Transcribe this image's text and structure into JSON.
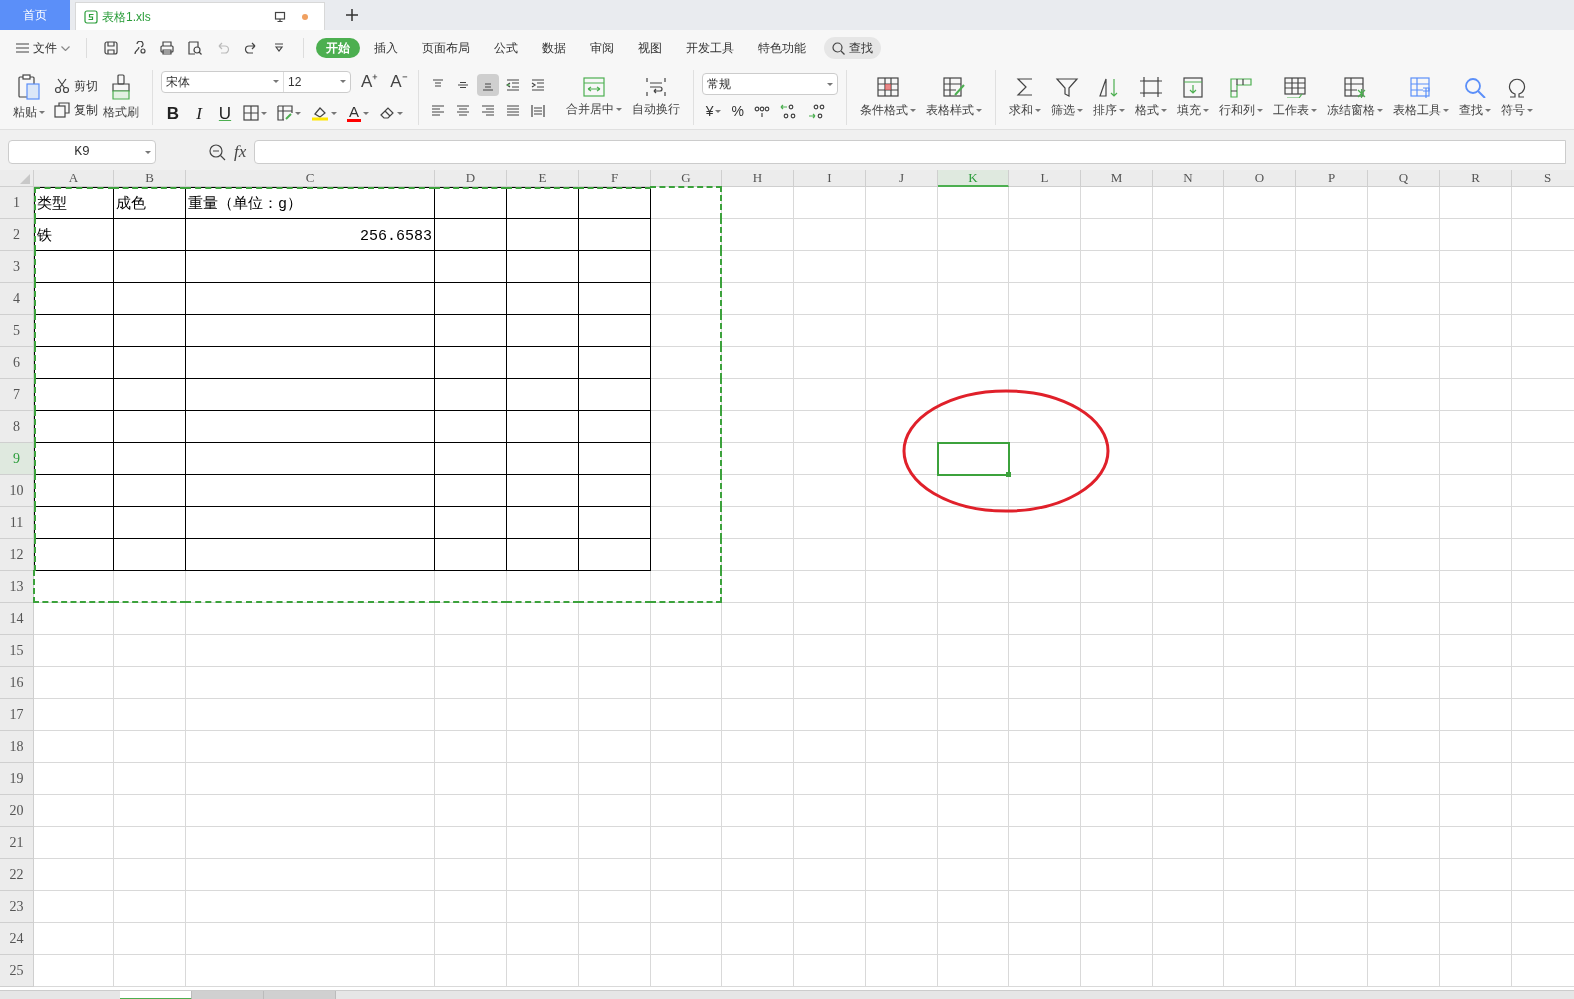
{
  "tabs": [
    {
      "label": "首页",
      "kind": "home",
      "selected": false
    },
    {
      "label": "表格1.xls",
      "kind": "file",
      "selected": true,
      "unsaved": true
    }
  ],
  "menu": {
    "file": "文件",
    "items": [
      {
        "label": "开始",
        "selected": true
      },
      {
        "label": "插入",
        "selected": false
      },
      {
        "label": "页面布局",
        "selected": false
      },
      {
        "label": "公式",
        "selected": false
      },
      {
        "label": "数据",
        "selected": false
      },
      {
        "label": "审阅",
        "selected": false
      },
      {
        "label": "视图",
        "selected": false
      },
      {
        "label": "开发工具",
        "selected": false
      },
      {
        "label": "特色功能",
        "selected": false
      }
    ],
    "search": "查找"
  },
  "clipboard": {
    "paste": "粘贴",
    "cut": "剪切",
    "copy": "复制",
    "painter": "格式刷"
  },
  "font": {
    "name": "宋体",
    "size": "12",
    "size_buttons": [
      "A⁺",
      "A⁻"
    ],
    "styles": [
      "B",
      "I",
      "U"
    ],
    "color_letter": "A"
  },
  "align": {
    "top_row": [
      {
        "selected": false
      },
      {
        "selected": false
      },
      {
        "selected": true
      },
      {
        "selected": false
      },
      {
        "selected": false
      }
    ],
    "bottom_row": [
      {
        "selected": false
      },
      {
        "selected": false
      },
      {
        "selected": false
      },
      {
        "selected": false
      },
      {
        "selected": false
      }
    ],
    "merge": "合并居中",
    "wrap": "自动换行"
  },
  "number": {
    "format": "常规",
    "symbols": [
      "¥",
      "%"
    ]
  },
  "styles": [
    "条件格式",
    "表格样式"
  ],
  "tools": [
    "求和",
    "筛选",
    "排序",
    "格式",
    "填充",
    "行和列",
    "工作表",
    "冻结窗格",
    "表格工具",
    "查找",
    "符号"
  ],
  "formula_bar": {
    "name_box": "K9",
    "fx": "fx"
  },
  "sheet": {
    "columns": [
      {
        "label": "A",
        "selected": false,
        "in_table": true,
        "in_copy_range": true
      },
      {
        "label": "B",
        "selected": false,
        "in_table": true,
        "in_copy_range": true
      },
      {
        "label": "C",
        "selected": false,
        "in_table": true,
        "in_copy_range": true
      },
      {
        "label": "D",
        "selected": false,
        "in_table": true,
        "in_copy_range": true
      },
      {
        "label": "E",
        "selected": false,
        "in_table": true,
        "in_copy_range": true
      },
      {
        "label": "F",
        "selected": false,
        "in_table": true,
        "in_copy_range": true
      },
      {
        "label": "G",
        "selected": false,
        "in_table": false,
        "in_copy_range": true
      },
      {
        "label": "H",
        "selected": false,
        "in_table": false,
        "in_copy_range": false
      },
      {
        "label": "I",
        "selected": false,
        "in_table": false,
        "in_copy_range": false
      },
      {
        "label": "J",
        "selected": false,
        "in_table": false,
        "in_copy_range": false
      },
      {
        "label": "K",
        "selected": true,
        "in_table": false,
        "in_copy_range": false
      },
      {
        "label": "L",
        "selected": false,
        "in_table": false,
        "in_copy_range": false
      },
      {
        "label": "M",
        "selected": false,
        "in_table": false,
        "in_copy_range": false
      },
      {
        "label": "N",
        "selected": false,
        "in_table": false,
        "in_copy_range": false
      },
      {
        "label": "O",
        "selected": false,
        "in_table": false,
        "in_copy_range": false
      },
      {
        "label": "P",
        "selected": false,
        "in_table": false,
        "in_copy_range": false
      },
      {
        "label": "Q",
        "selected": false,
        "in_table": false,
        "in_copy_range": false
      },
      {
        "label": "R",
        "selected": false,
        "in_table": false,
        "in_copy_range": false
      },
      {
        "label": "S",
        "selected": false,
        "in_table": false,
        "in_copy_range": false
      }
    ],
    "rows": [
      {
        "label": "1",
        "selected": false,
        "in_table": true,
        "in_copy_range": true,
        "cells": [
          "类型",
          "成色",
          "重量（单位：g）"
        ]
      },
      {
        "label": "2",
        "selected": false,
        "in_table": true,
        "in_copy_range": true,
        "cells": [
          "铁",
          "",
          "256.6583"
        ]
      },
      {
        "label": "3",
        "selected": false,
        "in_table": true,
        "in_copy_range": true
      },
      {
        "label": "4",
        "selected": false,
        "in_table": true,
        "in_copy_range": true
      },
      {
        "label": "5",
        "selected": false,
        "in_table": true,
        "in_copy_range": true
      },
      {
        "label": "6",
        "selected": false,
        "in_table": true,
        "in_copy_range": true
      },
      {
        "label": "7",
        "selected": false,
        "in_table": true,
        "in_copy_range": true
      },
      {
        "label": "8",
        "selected": false,
        "in_table": true,
        "in_copy_range": true
      },
      {
        "label": "9",
        "selected": true,
        "in_table": true,
        "in_copy_range": true
      },
      {
        "label": "10",
        "selected": false,
        "in_table": true,
        "in_copy_range": true
      },
      {
        "label": "11",
        "selected": false,
        "in_table": true,
        "in_copy_range": true
      },
      {
        "label": "12",
        "selected": false,
        "in_table": true,
        "in_copy_range": true
      },
      {
        "label": "13",
        "selected": false,
        "in_table": false,
        "in_copy_range": true
      },
      {
        "label": "14",
        "selected": false,
        "in_table": false,
        "in_copy_range": false
      },
      {
        "label": "15",
        "selected": false,
        "in_table": false,
        "in_copy_range": false
      },
      {
        "label": "16",
        "selected": false,
        "in_table": false,
        "in_copy_range": false
      },
      {
        "label": "17",
        "selected": false,
        "in_table": false,
        "in_copy_range": false
      },
      {
        "label": "18",
        "selected": false,
        "in_table": false,
        "in_copy_range": false
      },
      {
        "label": "19",
        "selected": false,
        "in_table": false,
        "in_copy_range": false
      },
      {
        "label": "20",
        "selected": false,
        "in_table": false,
        "in_copy_range": false
      },
      {
        "label": "21",
        "selected": false,
        "in_table": false,
        "in_copy_range": false
      },
      {
        "label": "22",
        "selected": false,
        "in_table": false,
        "in_copy_range": false
      },
      {
        "label": "23",
        "selected": false,
        "in_table": false,
        "in_copy_range": false
      },
      {
        "label": "24",
        "selected": false,
        "in_table": false,
        "in_copy_range": false
      },
      {
        "label": "25",
        "selected": false,
        "in_table": false,
        "in_copy_range": false
      }
    ]
  },
  "sheet_tabs": [
    {
      "selected": true
    },
    {
      "selected": false
    },
    {
      "selected": false
    }
  ]
}
